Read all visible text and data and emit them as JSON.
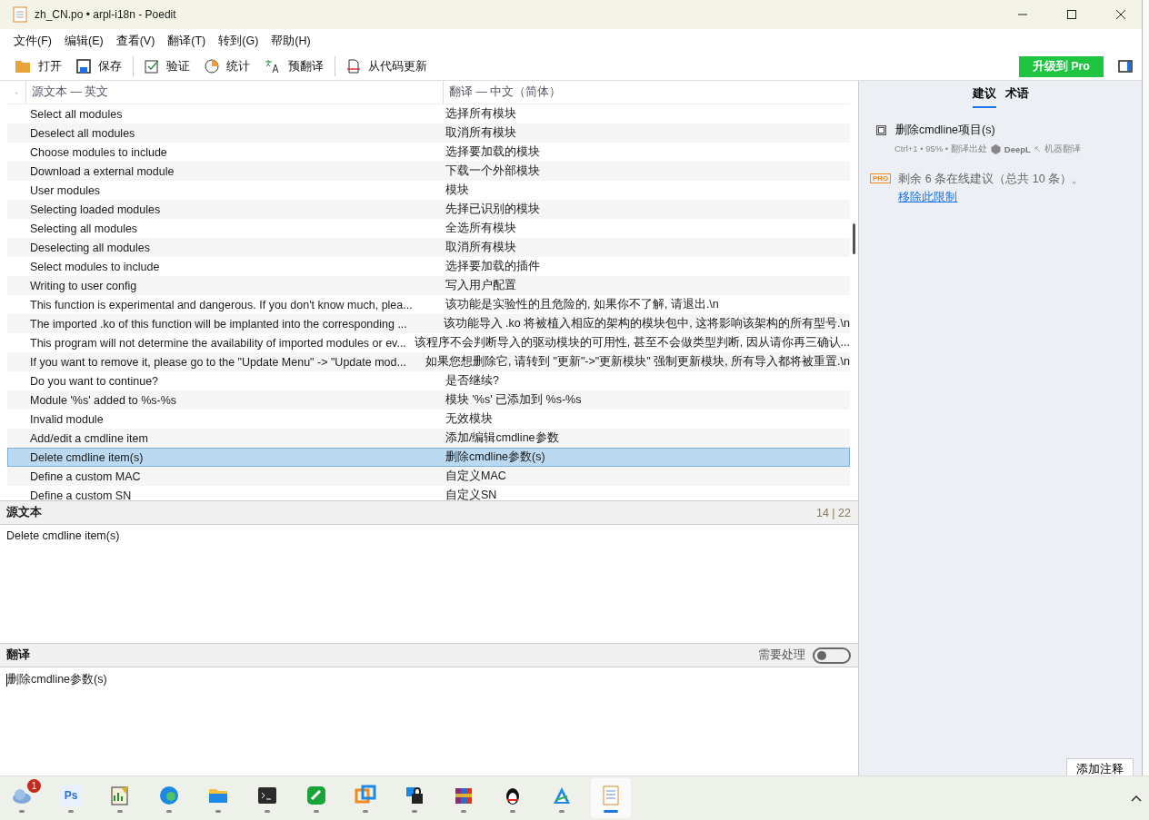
{
  "window": {
    "title": "zh_CN.po • arpl-i18n - Poedit"
  },
  "menu": [
    "文件(F)",
    "编辑(E)",
    "查看(V)",
    "翻译(T)",
    "转到(G)",
    "帮助(H)"
  ],
  "toolbar": [
    {
      "kind": "open",
      "label": "打开"
    },
    {
      "kind": "save",
      "label": "保存"
    },
    {
      "kind": "sep"
    },
    {
      "kind": "validate",
      "label": "验证"
    },
    {
      "kind": "stats",
      "label": "统计"
    },
    {
      "kind": "pretranslate",
      "label": "预翻译"
    },
    {
      "kind": "sep"
    },
    {
      "kind": "update",
      "label": "从代码更新"
    }
  ],
  "upgrade_button": "升级到 Pro",
  "list": {
    "marker": "·",
    "columns": [
      "源文本 — 英文",
      "翻译 — 中文（简体）"
    ],
    "rows": [
      {
        "source": "Select all modules",
        "translation": "选择所有模块",
        "selected": false
      },
      {
        "source": "Deselect all modules",
        "translation": "取消所有模块",
        "selected": false
      },
      {
        "source": "Choose modules to include",
        "translation": "选择要加载的模块",
        "selected": false
      },
      {
        "source": "Download a external module",
        "translation": "下载一个外部模块",
        "selected": false
      },
      {
        "source": "User modules",
        "translation": "模块",
        "selected": false
      },
      {
        "source": "Selecting loaded modules",
        "translation": "先择已识别的模块",
        "selected": false
      },
      {
        "source": "Selecting all modules",
        "translation": "全选所有模块",
        "selected": false
      },
      {
        "source": "Deselecting all modules",
        "translation": "取消所有模块",
        "selected": false
      },
      {
        "source": "Select modules to include",
        "translation": "选择要加载的插件",
        "selected": false
      },
      {
        "source": "Writing to user config",
        "translation": "写入用户配置",
        "selected": false
      },
      {
        "source": "This function is experimental and dangerous. If you don't know much, plea...",
        "translation": "该功能是实验性的且危险的, 如果你不了解, 请退出.\\n",
        "selected": false
      },
      {
        "source": "The imported .ko of this function will be implanted into the corresponding ...",
        "translation": "该功能导入 .ko 将被植入相应的架构的模块包中, 这将影响该架构的所有型号.\\n",
        "selected": false
      },
      {
        "source": "This program will not determine the availability of imported modules or ev...",
        "translation": "该程序不会判断导入的驱动模块的可用性, 甚至不会做类型判断, 因从请你再三确认...",
        "selected": false
      },
      {
        "source": "If you want to remove it, please go to the \"Update Menu\" -> \"Update mod...",
        "translation": "如果您想删除它, 请转到 \"更新\"->\"更新模块\" 强制更新模块, 所有导入都将被重置.\\n",
        "selected": false
      },
      {
        "source": "Do you want to continue?",
        "translation": "是否继续?",
        "selected": false
      },
      {
        "source": "Module '%s' added to %s-%s",
        "translation": "模块 '%s' 已添加到 %s-%s",
        "selected": false
      },
      {
        "source": "Invalid module",
        "translation": "无效模块",
        "selected": false
      },
      {
        "source": "Add/edit a cmdline item",
        "translation": "添加/编辑cmdline参数",
        "selected": false
      },
      {
        "source": "Delete cmdline item(s)",
        "translation": "删除cmdline参数(s)",
        "selected": true
      },
      {
        "source": "Define a custom MAC",
        "translation": "自定义MAC",
        "selected": false
      },
      {
        "source": "Define a custom SN",
        "translation": "自定义SN",
        "selected": false
      }
    ]
  },
  "source_pane": {
    "title": "源文本",
    "counter": "14 | 22",
    "text": "Delete cmdline item(s)"
  },
  "translation_pane": {
    "title": "翻译",
    "needs_work": {
      "label": "需要处理",
      "on": false
    },
    "text": "删除cmdline参数(s)"
  },
  "sidebar": {
    "tabs": [
      {
        "label": "建议",
        "selected": true
      },
      {
        "label": "术语",
        "selected": false
      }
    ],
    "suggestion": {
      "text": "删除cmdline项目(s)",
      "meta": "Ctrl+1 • 95% • 翻译出处",
      "provider": "DeepL",
      "kind_label": "机器翻译"
    },
    "pro_badge": "PRO",
    "pro_note": "剩余 6 条在线建议（总共 10 条）。",
    "pro_link": "移除此限制",
    "add_comment": "添加注释"
  },
  "taskbar": [
    {
      "kind": "weather",
      "badge": "1",
      "selected": false
    },
    {
      "kind": "ps",
      "label": "Ps",
      "selected": false
    },
    {
      "kind": "chart",
      "selected": false
    },
    {
      "kind": "edge",
      "selected": false
    },
    {
      "kind": "folder",
      "selected": false
    },
    {
      "kind": "terminal",
      "selected": false
    },
    {
      "kind": "green",
      "selected": false
    },
    {
      "kind": "squares",
      "selected": false
    },
    {
      "kind": "lock",
      "selected": false
    },
    {
      "kind": "books",
      "selected": false
    },
    {
      "kind": "penguin",
      "selected": false
    },
    {
      "kind": "triangle",
      "selected": false
    },
    {
      "kind": "poedit",
      "selected": true
    }
  ]
}
